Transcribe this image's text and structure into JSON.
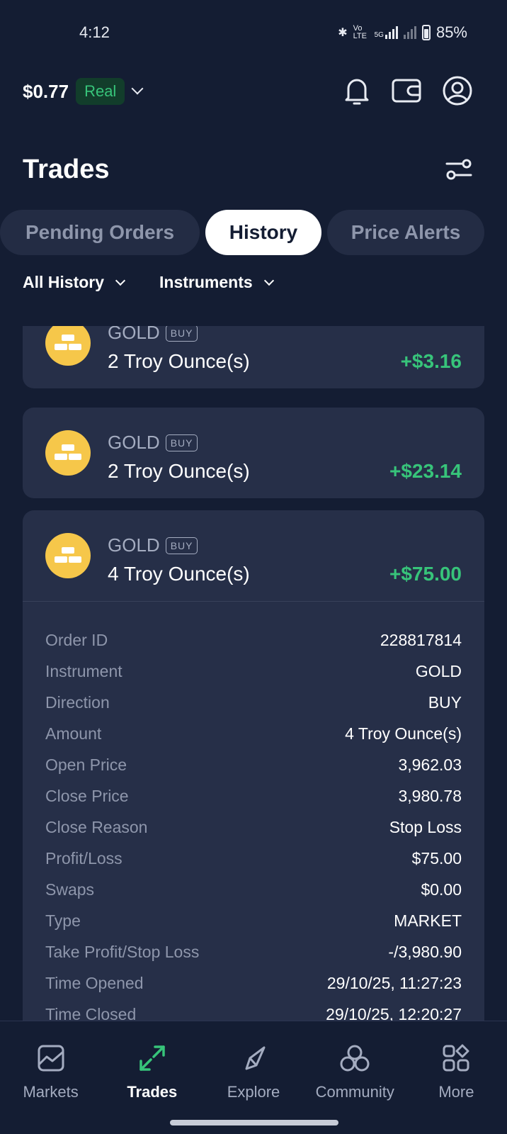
{
  "status_bar": {
    "time": "4:12",
    "network_labels": "Vo LTE",
    "signal_label": "5G",
    "battery": "85%"
  },
  "header": {
    "balance": "$0.77",
    "account_type": "Real"
  },
  "page": {
    "title": "Trades"
  },
  "tabs": [
    {
      "label": "Pending Orders",
      "active": false
    },
    {
      "label": "History",
      "active": true
    },
    {
      "label": "Price Alerts",
      "active": false
    }
  ],
  "filters": {
    "history": "All History",
    "instruments": "Instruments"
  },
  "trades": [
    {
      "instrument": "GOLD",
      "direction": "BUY",
      "amount": "2 Troy Ounce(s)",
      "pnl": "+$3.16"
    },
    {
      "instrument": "GOLD",
      "direction": "BUY",
      "amount": "2 Troy Ounce(s)",
      "pnl": "+$23.14"
    },
    {
      "instrument": "GOLD",
      "direction": "BUY",
      "amount": "4 Troy Ounce(s)",
      "pnl": "+$75.00",
      "details": [
        {
          "label": "Order ID",
          "value": "228817814"
        },
        {
          "label": "Instrument",
          "value": "GOLD"
        },
        {
          "label": "Direction",
          "value": "BUY"
        },
        {
          "label": "Amount",
          "value": "4 Troy Ounce(s)"
        },
        {
          "label": "Open Price",
          "value": "3,962.03"
        },
        {
          "label": "Close Price",
          "value": "3,980.78"
        },
        {
          "label": "Close Reason",
          "value": "Stop Loss"
        },
        {
          "label": "Profit/Loss",
          "value": "$75.00"
        },
        {
          "label": "Swaps",
          "value": "$0.00"
        },
        {
          "label": "Type",
          "value": "MARKET"
        },
        {
          "label": "Take Profit/Stop Loss",
          "value": "-/3,980.90"
        },
        {
          "label": "Time Opened",
          "value": "29/10/25, 11:27:23"
        },
        {
          "label": "Time Closed",
          "value": "29/10/25, 12:20:27"
        }
      ]
    }
  ],
  "bottom_nav": [
    {
      "label": "Markets",
      "icon": "chart-icon",
      "active": false
    },
    {
      "label": "Trades",
      "icon": "arrows-icon",
      "active": true
    },
    {
      "label": "Explore",
      "icon": "compass-icon",
      "active": false
    },
    {
      "label": "Community",
      "icon": "community-icon",
      "active": false
    },
    {
      "label": "More",
      "icon": "grid-icon",
      "active": false
    }
  ],
  "colors": {
    "background": "#141d33",
    "card": "#262f48",
    "profit_green": "#37c47a",
    "gold": "#f6c74a",
    "muted": "#8e96ab"
  }
}
